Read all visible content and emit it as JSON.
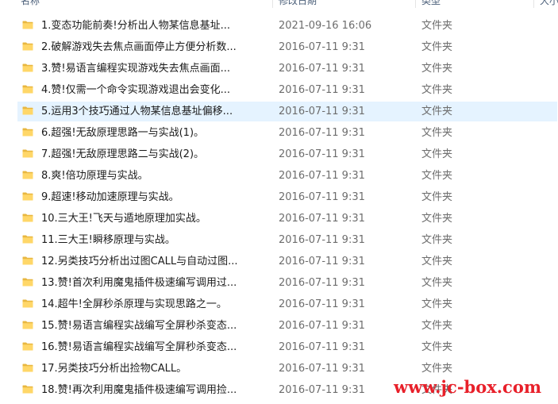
{
  "header": {
    "columns": [
      "名称",
      "修改日期",
      "类型",
      "大小"
    ]
  },
  "rows": [
    {
      "name": "1.变态功能前奏!分析出人物某信息基址...",
      "date": "2021-09-16 16:06",
      "type": "文件夹"
    },
    {
      "name": "2.破解游戏失去焦点画面停止方便分析数...",
      "date": "2016-07-11 9:31",
      "type": "文件夹"
    },
    {
      "name": "3.赞!易语言编程实现游戏失去焦点画面...",
      "date": "2016-07-11 9:31",
      "type": "文件夹"
    },
    {
      "name": "4.赞!仅需一个命令实现游戏退出会变化...",
      "date": "2016-07-11 9:31",
      "type": "文件夹"
    },
    {
      "name": "5.运用3个技巧通过人物某信息基址偏移...",
      "date": "2016-07-11 9:31",
      "type": "文件夹",
      "selected": true
    },
    {
      "name": "6.超强!无敌原理思路一与实战(1)。",
      "date": "2016-07-11 9:31",
      "type": "文件夹"
    },
    {
      "name": "7.超强!无敌原理思路二与实战(2)。",
      "date": "2016-07-11 9:31",
      "type": "文件夹"
    },
    {
      "name": "8.爽!倍功原理与实战。",
      "date": "2016-07-11 9:31",
      "type": "文件夹"
    },
    {
      "name": "9.超速!移动加速原理与实战。",
      "date": "2016-07-11 9:31",
      "type": "文件夹"
    },
    {
      "name": "10.三大王!飞天与遁地原理加实战。",
      "date": "2016-07-11 9:31",
      "type": "文件夹"
    },
    {
      "name": "11.三大王!瞬移原理与实战。",
      "date": "2016-07-11 9:31",
      "type": "文件夹"
    },
    {
      "name": "12.另类技巧分析出过图CALL与自动过图...",
      "date": "2016-07-11 9:31",
      "type": "文件夹"
    },
    {
      "name": "13.赞!首次利用魔鬼插件极速编写调用过...",
      "date": "2016-07-11 9:31",
      "type": "文件夹"
    },
    {
      "name": "14.超牛!全屏秒杀原理与实现思路之一。",
      "date": "2016-07-11 9:31",
      "type": "文件夹"
    },
    {
      "name": "15.赞!易语言编程实战编写全屏秒杀变态...",
      "date": "2016-07-11 9:31",
      "type": "文件夹"
    },
    {
      "name": "16.赞!易语言编程实战编写全屏秒杀变态...",
      "date": "2016-07-11 9:31",
      "type": "文件夹"
    },
    {
      "name": "17.另类技巧分析出捡物CALL。",
      "date": "2016-07-11 9:31",
      "type": "文件夹"
    },
    {
      "name": "18.赞!再次利用魔鬼插件极速编写调用捡...",
      "date": "2016-07-11 9:31",
      "type": "文件夹"
    }
  ],
  "watermark": "www.jc-box.com",
  "colors": {
    "folder": "#ffd768",
    "selection": "#e5f3ff",
    "watermark": "#e8202a"
  },
  "icons": {
    "row_icon": "folder-icon"
  }
}
